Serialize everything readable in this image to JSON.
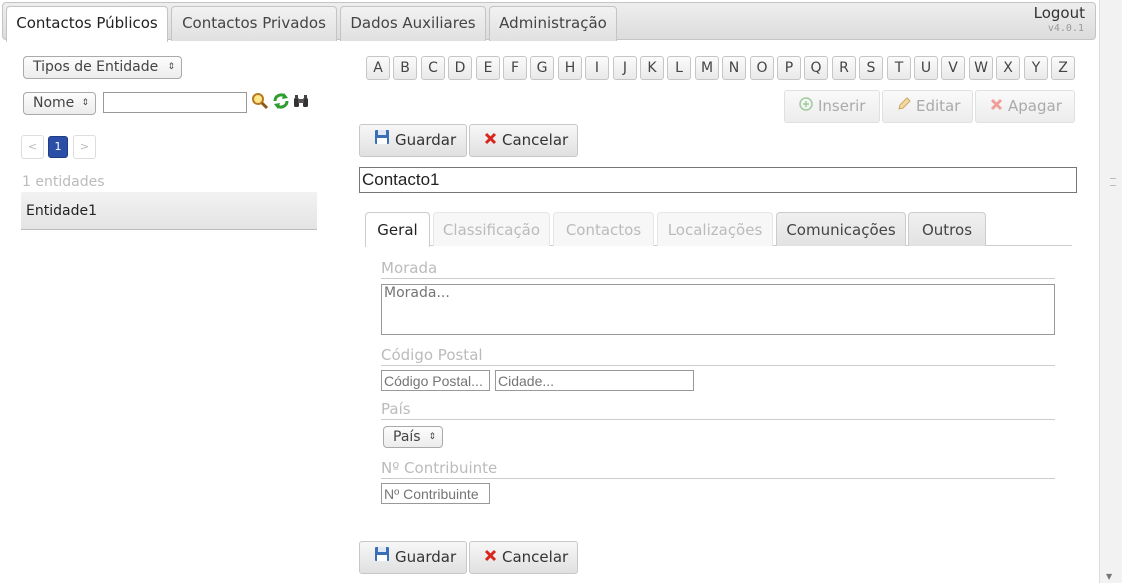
{
  "nav": {
    "tabs": [
      "Contactos Públicos",
      "Contactos Privados",
      "Dados Auxiliares",
      "Administração"
    ],
    "logout": "Logout",
    "version": "v4.0.1"
  },
  "sidebar": {
    "entity_types": "Tipos de Entidade",
    "field_select": "Nome",
    "search_value": "",
    "pagination": {
      "prev": "<",
      "current": "1",
      "next": ">"
    },
    "count": "1 entidades",
    "items": [
      "Entidade1"
    ]
  },
  "letters": [
    "A",
    "B",
    "C",
    "D",
    "E",
    "F",
    "G",
    "H",
    "I",
    "J",
    "K",
    "L",
    "M",
    "N",
    "O",
    "P",
    "Q",
    "R",
    "S",
    "T",
    "U",
    "V",
    "W",
    "X",
    "Y",
    "Z"
  ],
  "actions": {
    "insert": "Inserir",
    "edit": "Editar",
    "delete": "Apagar"
  },
  "form": {
    "save": "Guardar",
    "cancel": "Cancelar",
    "name": "Contacto1",
    "tabs": [
      "Geral",
      "Classificação",
      "Contactos",
      "Localizações",
      "Comunicações",
      "Outros"
    ],
    "morada_label": "Morada",
    "morada_placeholder": "Morada...",
    "postal_label": "Código Postal",
    "postal_placeholder": "Código Postal...",
    "city_placeholder": "Cidade...",
    "country_label": "País",
    "country_select": "País",
    "nif_label": "Nº Contribuinte",
    "nif_placeholder": "Nº Contribuinte"
  },
  "colors": {
    "accent": "#2b4fa6",
    "cancel_red": "#d9261c",
    "refresh_green": "#2e9e2e"
  }
}
